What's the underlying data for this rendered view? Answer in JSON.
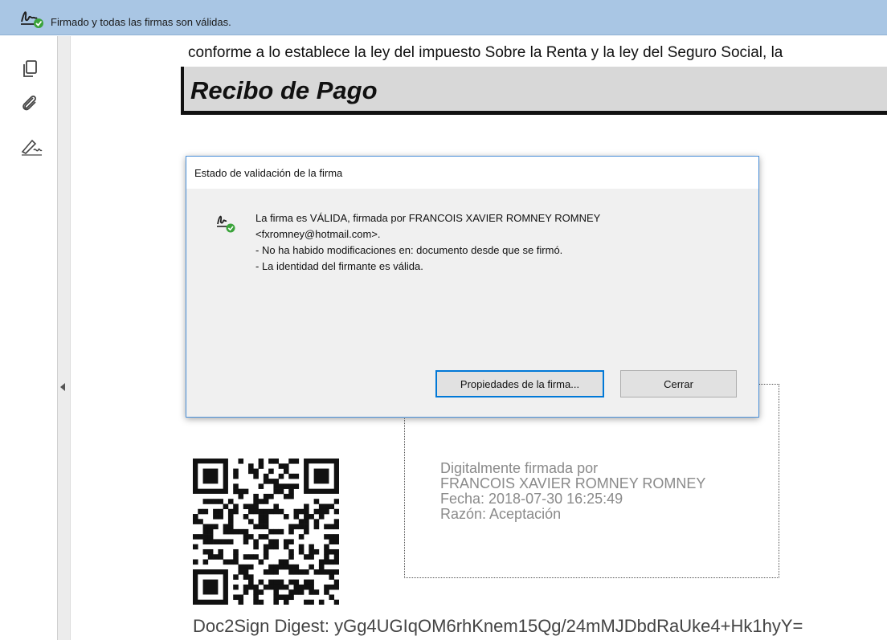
{
  "banner": {
    "message": "Firmado y todas las firmas son válidas."
  },
  "sidebar": {
    "tools": [
      {
        "icon": "pages-icon"
      },
      {
        "icon": "attachment-icon"
      },
      {
        "icon": "signature-panel-icon"
      }
    ]
  },
  "document": {
    "line1": "conforme a lo establece la ley del impuesto Sobre la Renta y la ley del Seguro Social, la",
    "title": "Recibo de Pago",
    "signature_lines": [
      "Digitalmente firmada por",
      "FRANCOIS XAVIER ROMNEY ROMNEY",
      "Fecha: 2018-07-30 16:25:49",
      "Razón: Aceptación"
    ],
    "digest": "Doc2Sign Digest: yGg4UGIqOM6rhKnem15Qg/24mMJDbdRaUke4+Hk1hyY="
  },
  "dialog": {
    "title": "Estado de validación de la firma",
    "lines": [
      "La firma es VÁLIDA, firmada por FRANCOIS XAVIER ROMNEY ROMNEY",
      "<fxromney@hotmail.com>.",
      "- No ha habido modificaciones en: documento desde que se firmó.",
      "- La identidad del firmante es válida."
    ],
    "properties_button": "Propiedades de la firma...",
    "close_button": "Cerrar"
  },
  "colors": {
    "banner_bg": "#a9c6e4",
    "valid_check": "#3aa33a",
    "dialog_border": "#4a90d9"
  }
}
